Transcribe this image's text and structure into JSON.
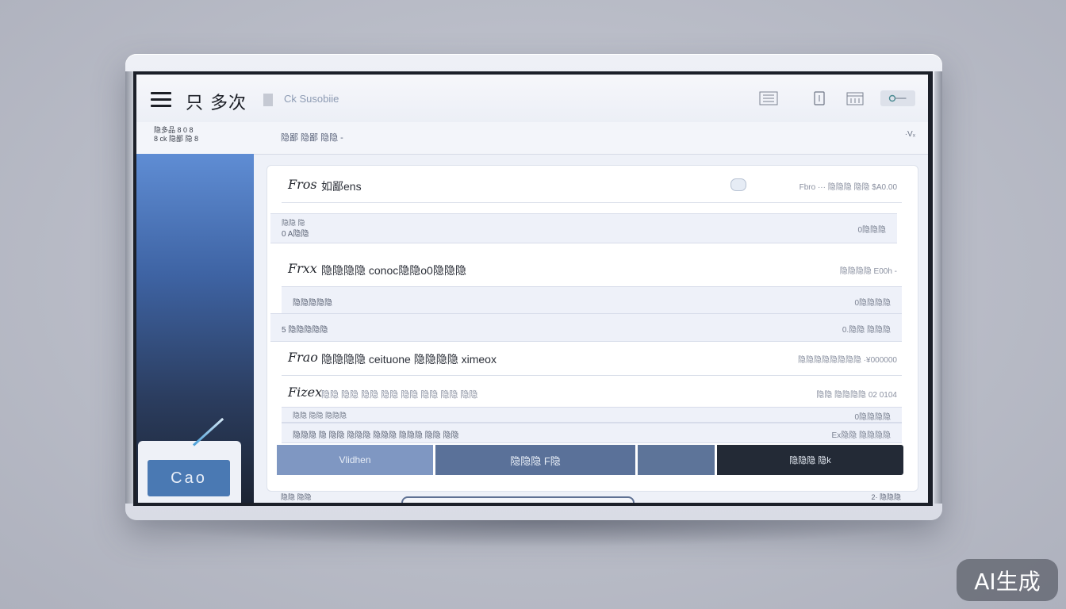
{
  "titlebar": {
    "brand": "只 多次",
    "subtitle": "Ck Susobiie",
    "icons": [
      "grid-icon",
      "phone-icon",
      "calendar-icon",
      "key-icon"
    ]
  },
  "subbar": {
    "left_line1": "隐多品 8 0 8",
    "left_line2": "8 ck 隐鄙 隐 8",
    "middle": "隐鄙 隐鄙 隐隐 -",
    "right": "·Vₓ"
  },
  "sidebar": {
    "button_label": "Cao"
  },
  "rows": [
    {
      "kind": "head",
      "icon_text": "Fros",
      "title": "如鄙ens",
      "right": "Fbro  ··· 隐隐隐 隐隐 $A0.00"
    },
    {
      "kind": "band",
      "line1": "隐隐 隐",
      "line2": "0 A隐隐",
      "right": "0隐隐隐"
    },
    {
      "kind": "head",
      "icon_text": "Frxx",
      "title": "隐隐隐隐 conoc隐隐o0隐隐隐",
      "right": "隐隐隐隐 E00h -"
    },
    {
      "kind": "band",
      "line1": "",
      "line2": "隐隐隐隐隐",
      "right": "0隐隐隐隐"
    },
    {
      "kind": "band",
      "line1": "",
      "line2": "5 隐隐隐隐隐",
      "right": "0.隐隐 隐隐隐"
    },
    {
      "kind": "head",
      "icon_text": "Frao",
      "title": "隐隐隐隐 ceituone 隐隐隐隐 ximeox",
      "right": "隐隐隐隐隐隐隐隐 ·¥000000"
    },
    {
      "kind": "head",
      "icon_text": "Fizex",
      "title": "隐隐 隐隐 隐隐 隐隐 隐隐 隐隐 隐隐 隐隐",
      "right": "隐隐 隐隐隐隐 02 0104"
    },
    {
      "kind": "band",
      "line1": "隐隐 隐隐 隐隐隐",
      "line2": "",
      "right": "0隐隐隐隐"
    },
    {
      "kind": "band",
      "line1": "",
      "line2": "隐隐隐 隐 隐隐 隐隐隐 隐隐隐 隐隐隐 隐隐 隐隐",
      "right": "Ex隐隐 隐隐隐隐"
    }
  ],
  "actions": [
    "Vlidhen",
    "隐隐隐 F隐",
    "",
    "隐隐隐 隐k"
  ],
  "footer": {
    "left": "隐隐 隐隐",
    "right": "2·  隐隐隐"
  },
  "badge": "AI生成",
  "colors": {
    "sidebar_top": "#5f8dd4",
    "sidebar_bottom": "#1c2433",
    "accent_button": "#4a79b3",
    "action_dark": "#232a36"
  }
}
